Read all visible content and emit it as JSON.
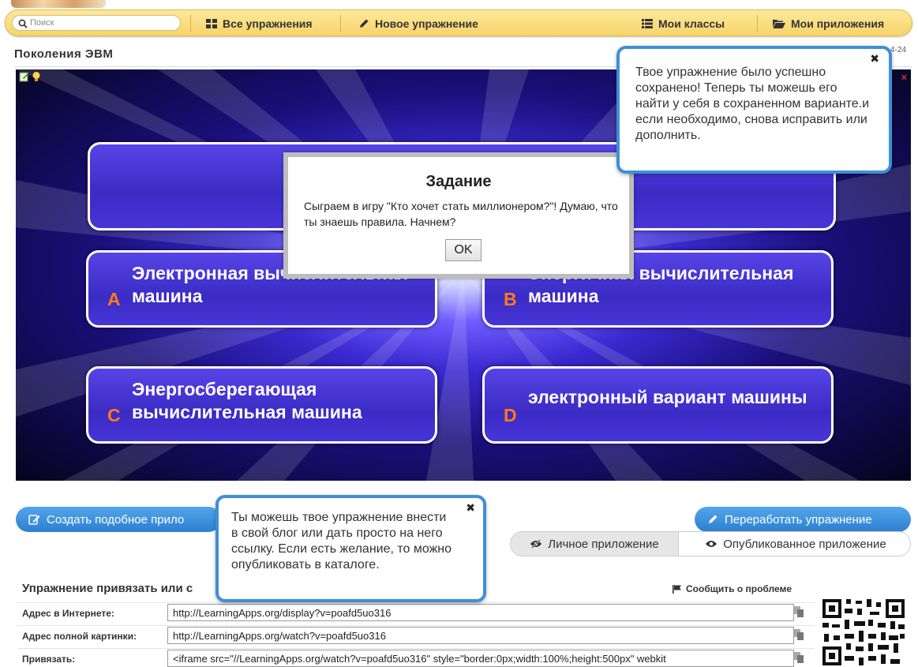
{
  "topbar": {
    "search_placeholder": "Поиск",
    "all_exercises": "Все упражнения",
    "new_exercise": "Новое упражнение",
    "my_classes": "Мои классы",
    "my_apps": "Мои приложения"
  },
  "page": {
    "title": "Поколения ЭВМ",
    "date_fragment": "4-24"
  },
  "game": {
    "answers": [
      {
        "letter": "A",
        "text": "Электронная вычислительная машина"
      },
      {
        "letter": "B",
        "text": "Энергичная вычислительная машина"
      },
      {
        "letter": "C",
        "text": "Энергосберегающая вычислительная машина"
      },
      {
        "letter": "D",
        "text": "электронный вариант машины"
      }
    ],
    "dialog": {
      "title": "Задание",
      "text": "Сыграем в игру \"Кто хочет стать миллионером?\"! Думаю, что ты знаешь правила. Начнем?",
      "ok": "OK"
    }
  },
  "tips": {
    "saved": "Твое упражнение было успешно сохранено! Теперь ты можешь его найти у себя в сохраненном варианте.и если необходимо, снова исправить или дополнить.",
    "embed": "Ты можешь твое упражнение внести в свой блог или дать просто на него ссылку. Если есть желание, то можно опубликовать в каталоге.",
    "close": "✖"
  },
  "actions": {
    "create_similar": "Создать подобное прило",
    "rework": "Переработать упражнение",
    "private_app": "Личное приложение",
    "published_app": "Опубликованное приложение"
  },
  "embed": {
    "heading": "Упражнение привязать или с",
    "report": "Сообщить о проблеме",
    "rows": [
      {
        "label": "Адрес в Интернете:",
        "value": "http://LearningApps.org/display?v=poafd5uo316"
      },
      {
        "label": "Адрес полной картинки:",
        "value": "http://LearningApps.org/watch?v=poafd5uo316"
      },
      {
        "label": "Привязать:",
        "value": "<iframe src=\"//LearningApps.org/watch?v=poafd5uo316\" style=\"border:0px;width:100%;height:500px\" webkit"
      }
    ]
  },
  "colors": {
    "topbar": "#f7d46a",
    "accent_blue": "#3f8fd8",
    "answer_letter": "#ff7a1a"
  }
}
